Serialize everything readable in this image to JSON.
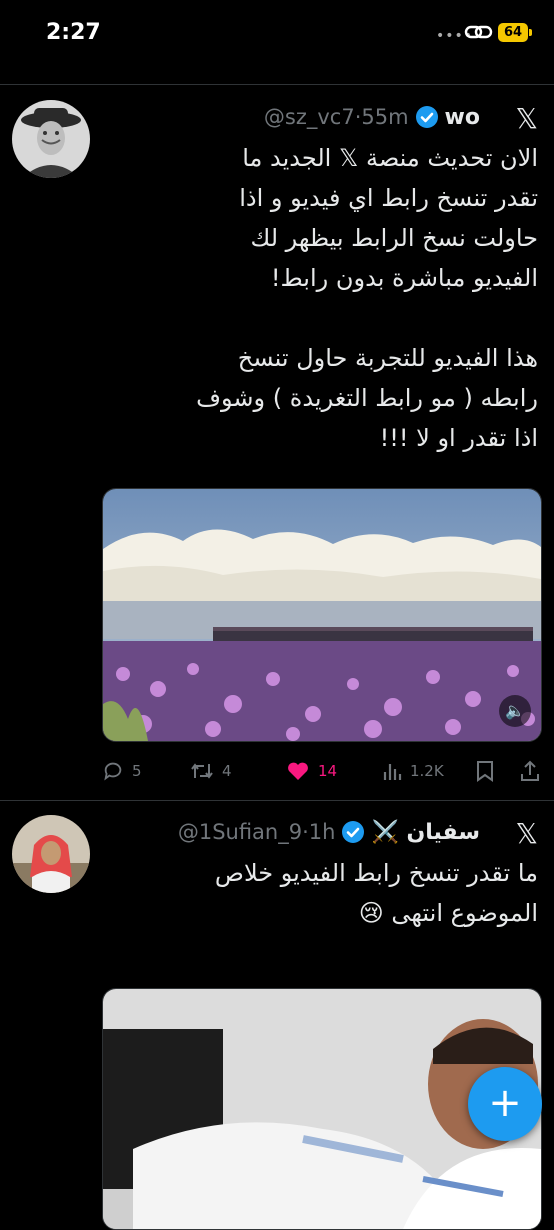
{
  "status_bar": {
    "time": "2:27",
    "dots": "••••",
    "battery": "64"
  },
  "tweets": [
    {
      "name": "wo",
      "handle": "@sz_vc7·55m",
      "text": "الان تحديث منصة 𝕏 الجديد ما\nتقدر تنسخ رابط اي فيديو و اذا\nحاولت نسخ الرابط بيظهر لك\nالفيديو مباشرة بدون رابط!\n\nهذا الفيديو للتجربة حاول تنسخ\nرابطه ( مو رابط التغريدة ) وشوف\nاذا تقدر او لا !!!",
      "x_logo": "𝕏",
      "replies": "5",
      "reposts": "4",
      "likes": "14",
      "views": "1.2K"
    },
    {
      "name": "سفيان ⚔️",
      "handle": "@1Sufian_9·1h",
      "text": "ما تقدر تنسخ رابط الفيديو خلاص\nالموضوع انتهى 😢",
      "x_logo": "𝕏"
    }
  ],
  "icons": {
    "verified": "verified-badge-icon",
    "reply": "reply-icon",
    "repost": "repost-icon",
    "like": "heart-icon",
    "views": "views-icon",
    "bookmark": "bookmark-icon",
    "share": "share-icon",
    "compose": "compose-plus-icon",
    "sound": "speaker-icon"
  },
  "colors": {
    "accent": "#1d9bf0",
    "like": "#f91880",
    "muted": "#71767b",
    "battery": "#f5c800"
  }
}
